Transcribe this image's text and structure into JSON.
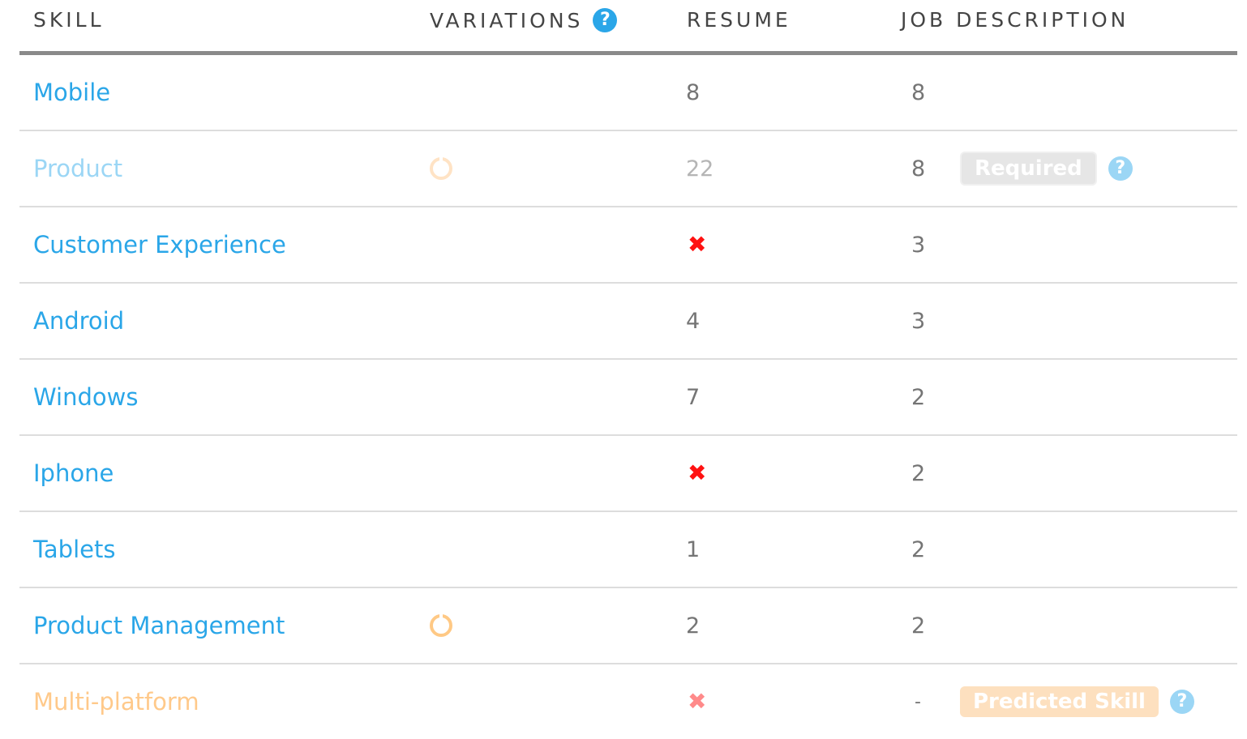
{
  "colors": {
    "accent": "#2aa6e8",
    "accent_faded": "#9bd6f5",
    "predicted": "#ffc98a",
    "missing": "#ff1111",
    "header_rule": "#8a8a8a",
    "row_rule": "#dddddd",
    "number_text": "#757575"
  },
  "header": {
    "skill": "SKILL",
    "variations": "VARIATIONS",
    "variations_help_icon": "?",
    "resume": "RESUME",
    "job_description": "JOB DESCRIPTION"
  },
  "rows": [
    {
      "skill": "Mobile",
      "variations": null,
      "resume": "8",
      "job": "8"
    },
    {
      "skill": "Product",
      "variations": "spinner-icon",
      "resume": "22",
      "job": "8",
      "badge": "Required",
      "help_icon": "?"
    },
    {
      "skill": "Customer Experience",
      "variations": null,
      "resume": "missing-x-icon",
      "job": "3"
    },
    {
      "skill": "Android",
      "variations": null,
      "resume": "4",
      "job": "3"
    },
    {
      "skill": "Windows",
      "variations": null,
      "resume": "7",
      "job": "2"
    },
    {
      "skill": "Iphone",
      "variations": null,
      "resume": "missing-x-icon",
      "job": "2"
    },
    {
      "skill": "Tablets",
      "variations": null,
      "resume": "1",
      "job": "2"
    },
    {
      "skill": "Product Management",
      "variations": "spinner-icon",
      "resume": "2",
      "job": "2"
    },
    {
      "skill": "Multi-platform",
      "variations": null,
      "resume": "missing-x-icon",
      "job": "-",
      "badge": "Predicted Skill",
      "help_icon": "?"
    }
  ],
  "icons": {
    "x": "✖",
    "help": "?"
  }
}
